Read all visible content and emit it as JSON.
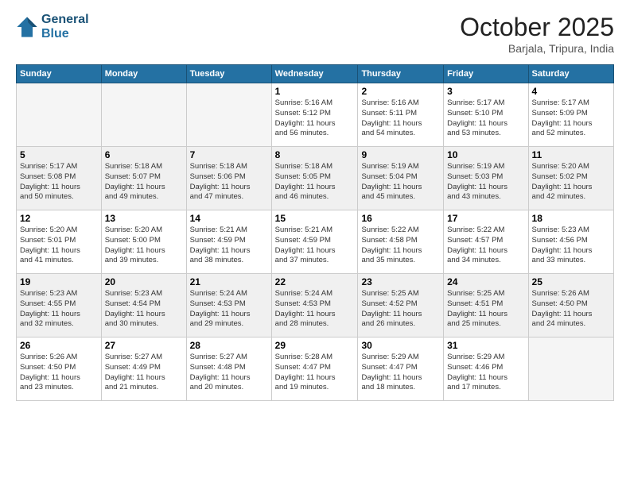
{
  "logo": {
    "line1": "General",
    "line2": "Blue"
  },
  "header": {
    "month": "October 2025",
    "location": "Barjala, Tripura, India"
  },
  "weekdays": [
    "Sunday",
    "Monday",
    "Tuesday",
    "Wednesday",
    "Thursday",
    "Friday",
    "Saturday"
  ],
  "weeks": [
    [
      {
        "day": "",
        "info": ""
      },
      {
        "day": "",
        "info": ""
      },
      {
        "day": "",
        "info": ""
      },
      {
        "day": "1",
        "info": "Sunrise: 5:16 AM\nSunset: 5:12 PM\nDaylight: 11 hours\nand 56 minutes."
      },
      {
        "day": "2",
        "info": "Sunrise: 5:16 AM\nSunset: 5:11 PM\nDaylight: 11 hours\nand 54 minutes."
      },
      {
        "day": "3",
        "info": "Sunrise: 5:17 AM\nSunset: 5:10 PM\nDaylight: 11 hours\nand 53 minutes."
      },
      {
        "day": "4",
        "info": "Sunrise: 5:17 AM\nSunset: 5:09 PM\nDaylight: 11 hours\nand 52 minutes."
      }
    ],
    [
      {
        "day": "5",
        "info": "Sunrise: 5:17 AM\nSunset: 5:08 PM\nDaylight: 11 hours\nand 50 minutes."
      },
      {
        "day": "6",
        "info": "Sunrise: 5:18 AM\nSunset: 5:07 PM\nDaylight: 11 hours\nand 49 minutes."
      },
      {
        "day": "7",
        "info": "Sunrise: 5:18 AM\nSunset: 5:06 PM\nDaylight: 11 hours\nand 47 minutes."
      },
      {
        "day": "8",
        "info": "Sunrise: 5:18 AM\nSunset: 5:05 PM\nDaylight: 11 hours\nand 46 minutes."
      },
      {
        "day": "9",
        "info": "Sunrise: 5:19 AM\nSunset: 5:04 PM\nDaylight: 11 hours\nand 45 minutes."
      },
      {
        "day": "10",
        "info": "Sunrise: 5:19 AM\nSunset: 5:03 PM\nDaylight: 11 hours\nand 43 minutes."
      },
      {
        "day": "11",
        "info": "Sunrise: 5:20 AM\nSunset: 5:02 PM\nDaylight: 11 hours\nand 42 minutes."
      }
    ],
    [
      {
        "day": "12",
        "info": "Sunrise: 5:20 AM\nSunset: 5:01 PM\nDaylight: 11 hours\nand 41 minutes."
      },
      {
        "day": "13",
        "info": "Sunrise: 5:20 AM\nSunset: 5:00 PM\nDaylight: 11 hours\nand 39 minutes."
      },
      {
        "day": "14",
        "info": "Sunrise: 5:21 AM\nSunset: 4:59 PM\nDaylight: 11 hours\nand 38 minutes."
      },
      {
        "day": "15",
        "info": "Sunrise: 5:21 AM\nSunset: 4:59 PM\nDaylight: 11 hours\nand 37 minutes."
      },
      {
        "day": "16",
        "info": "Sunrise: 5:22 AM\nSunset: 4:58 PM\nDaylight: 11 hours\nand 35 minutes."
      },
      {
        "day": "17",
        "info": "Sunrise: 5:22 AM\nSunset: 4:57 PM\nDaylight: 11 hours\nand 34 minutes."
      },
      {
        "day": "18",
        "info": "Sunrise: 5:23 AM\nSunset: 4:56 PM\nDaylight: 11 hours\nand 33 minutes."
      }
    ],
    [
      {
        "day": "19",
        "info": "Sunrise: 5:23 AM\nSunset: 4:55 PM\nDaylight: 11 hours\nand 32 minutes."
      },
      {
        "day": "20",
        "info": "Sunrise: 5:23 AM\nSunset: 4:54 PM\nDaylight: 11 hours\nand 30 minutes."
      },
      {
        "day": "21",
        "info": "Sunrise: 5:24 AM\nSunset: 4:53 PM\nDaylight: 11 hours\nand 29 minutes."
      },
      {
        "day": "22",
        "info": "Sunrise: 5:24 AM\nSunset: 4:53 PM\nDaylight: 11 hours\nand 28 minutes."
      },
      {
        "day": "23",
        "info": "Sunrise: 5:25 AM\nSunset: 4:52 PM\nDaylight: 11 hours\nand 26 minutes."
      },
      {
        "day": "24",
        "info": "Sunrise: 5:25 AM\nSunset: 4:51 PM\nDaylight: 11 hours\nand 25 minutes."
      },
      {
        "day": "25",
        "info": "Sunrise: 5:26 AM\nSunset: 4:50 PM\nDaylight: 11 hours\nand 24 minutes."
      }
    ],
    [
      {
        "day": "26",
        "info": "Sunrise: 5:26 AM\nSunset: 4:50 PM\nDaylight: 11 hours\nand 23 minutes."
      },
      {
        "day": "27",
        "info": "Sunrise: 5:27 AM\nSunset: 4:49 PM\nDaylight: 11 hours\nand 21 minutes."
      },
      {
        "day": "28",
        "info": "Sunrise: 5:27 AM\nSunset: 4:48 PM\nDaylight: 11 hours\nand 20 minutes."
      },
      {
        "day": "29",
        "info": "Sunrise: 5:28 AM\nSunset: 4:47 PM\nDaylight: 11 hours\nand 19 minutes."
      },
      {
        "day": "30",
        "info": "Sunrise: 5:29 AM\nSunset: 4:47 PM\nDaylight: 11 hours\nand 18 minutes."
      },
      {
        "day": "31",
        "info": "Sunrise: 5:29 AM\nSunset: 4:46 PM\nDaylight: 11 hours\nand 17 minutes."
      },
      {
        "day": "",
        "info": ""
      }
    ]
  ]
}
